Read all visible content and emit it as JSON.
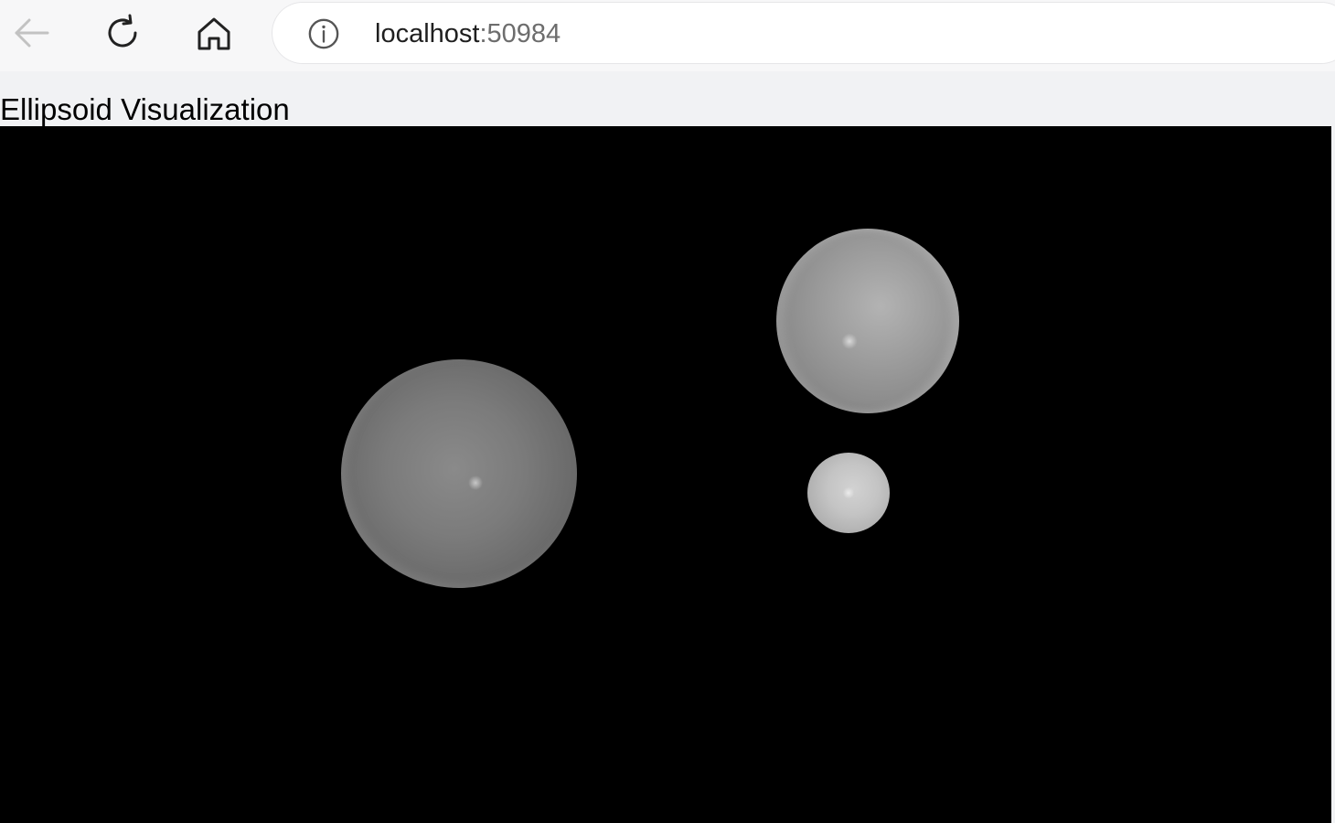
{
  "browser": {
    "url_host": "localhost",
    "url_port": ":50984",
    "icons": {
      "back": "arrow-left-icon",
      "reload": "reload-icon",
      "home": "home-icon",
      "info": "info-icon"
    }
  },
  "page": {
    "heading": "Ellipsoid Visualization",
    "background": "#000000",
    "ellipsoids": [
      {
        "name": "large-left-ellipsoid",
        "color": "#7b7b7b"
      },
      {
        "name": "upper-right-ellipsoid",
        "color": "#a1a1a1"
      },
      {
        "name": "small-ellipsoid",
        "color": "#c4c4c4"
      }
    ]
  }
}
